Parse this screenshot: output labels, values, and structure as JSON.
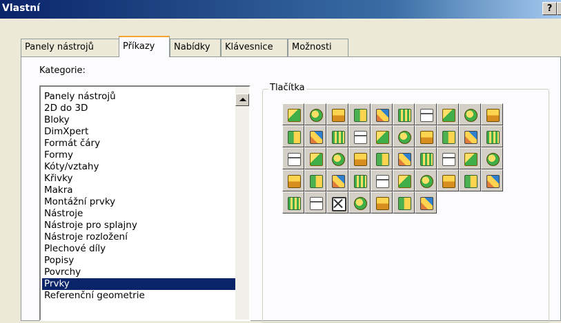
{
  "window": {
    "title": "Vlastní",
    "help_label": "?",
    "close_label": "×"
  },
  "tabs": [
    {
      "label": "Panely nástrojů",
      "active": false
    },
    {
      "label": "Příkazy",
      "active": true
    },
    {
      "label": "Nabídky",
      "active": false
    },
    {
      "label": "Klávesnice",
      "active": false
    },
    {
      "label": "Možnosti",
      "active": false
    }
  ],
  "categories": {
    "label": "Kategorie:",
    "items": [
      "Panely nástrojů",
      "2D do 3D",
      "Bloky",
      "DimXpert",
      "Formát čáry",
      "Formy",
      "Kóty/vztahy",
      "Křivky",
      "Makra",
      "Montážní prvky",
      "Nástroje",
      "Nástroje pro splajny",
      "Nástroje rozložení",
      "Plechové díly",
      "Popisy",
      "Povrchy",
      "Prvky",
      "Referenční geometrie"
    ],
    "selected": "Prvky"
  },
  "buttons": {
    "label": "Tlačítka",
    "rows": [
      [
        "feature-extrude",
        "feature-revolve",
        "feature-sweep",
        "feature-loft",
        "feature-boundary",
        "feature-cut-extrude",
        "feature-cut-revolve",
        "feature-cut-sweep",
        "feature-cut-loft",
        "feature-cut-boundary"
      ],
      [
        "feature-fillet",
        "feature-chamfer",
        "feature-rib",
        "feature-draft",
        "feature-shell",
        "feature-wrap",
        "feature-dome",
        "feature-mirror",
        "feature-pattern",
        "feature-hole"
      ],
      [
        "feature-hole-wizard",
        "feature-freeform",
        "feature-split",
        "feature-combine",
        "feature-deform",
        "feature-indent",
        "feature-flex",
        "feature-scale",
        "feature-move-face",
        "feature-delete-face"
      ],
      [
        "feature-linear-pattern",
        "feature-circular-pattern",
        "feature-curve-pattern",
        "feature-sketch-pattern",
        "feature-table-pattern",
        "feature-fill-pattern",
        "feature-variable-pattern",
        "feature-mirror-body",
        "feature-move-body",
        "feature-insert-part"
      ],
      [
        "feature-joint",
        "feature-cavity",
        "feature-delete-body",
        "feature-curve-driven",
        "feature-copy-body",
        "feature-move-copy",
        "feature-intersect"
      ]
    ]
  }
}
